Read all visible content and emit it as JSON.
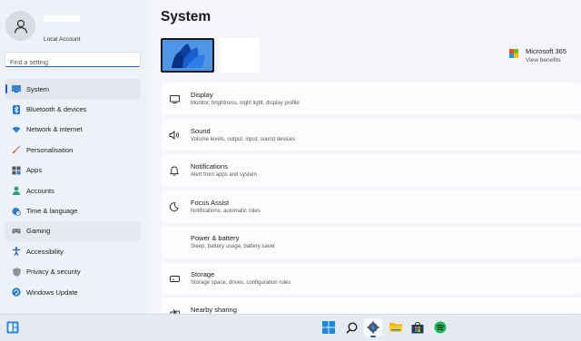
{
  "account": {
    "subtitle": "Local Account"
  },
  "search": {
    "placeholder": "Find a setting"
  },
  "sidebar": {
    "items": [
      {
        "label": "System",
        "icon": "system-icon"
      },
      {
        "label": "Bluetooth & devices",
        "icon": "bluetooth-icon"
      },
      {
        "label": "Network & internet",
        "icon": "wifi-icon"
      },
      {
        "label": "Personalisation",
        "icon": "brush-icon"
      },
      {
        "label": "Apps",
        "icon": "apps-icon"
      },
      {
        "label": "Accounts",
        "icon": "person-icon"
      },
      {
        "label": "Time & language",
        "icon": "globe-clock-icon"
      },
      {
        "label": "Gaming",
        "icon": "gamepad-icon"
      },
      {
        "label": "Accessibility",
        "icon": "accessibility-icon"
      },
      {
        "label": "Privacy & security",
        "icon": "shield-icon"
      },
      {
        "label": "Windows Update",
        "icon": "update-icon"
      }
    ]
  },
  "main": {
    "title": "System",
    "m365": {
      "title": "Microsoft 365",
      "subtitle": "View benefits"
    },
    "cards": [
      {
        "title": "Display",
        "subtitle": "Monitor, brightness, night light, display profile",
        "icon": "monitor-icon"
      },
      {
        "title": "Sound",
        "subtitle": "Volume levels, output, input, sound devices",
        "icon": "speaker-icon"
      },
      {
        "title": "Notifications",
        "subtitle": "Alert from apps and system",
        "icon": "bell-icon"
      },
      {
        "title": "Focus Assist",
        "subtitle": "Notifications, automatic rules",
        "icon": "moon-icon"
      },
      {
        "title": "Power & battery",
        "subtitle": "Sleep, battery usage, battery saver",
        "icon": "power-icon"
      },
      {
        "title": "Storage",
        "subtitle": "Storage space, drives, configuration rules",
        "icon": "storage-icon"
      },
      {
        "title": "Nearby sharing",
        "subtitle": "",
        "icon": "share-icon"
      }
    ]
  },
  "colors": {
    "accent": "#1a5fb4",
    "background": "#f3f5fa",
    "sidebar": "#eef1f7",
    "taskbar": "#e6ebf3"
  },
  "taskbar": {
    "icons": [
      "widgets-icon",
      "start-icon",
      "search-icon",
      "settings-icon",
      "file-explorer-icon",
      "store-icon",
      "spotify-icon"
    ]
  }
}
